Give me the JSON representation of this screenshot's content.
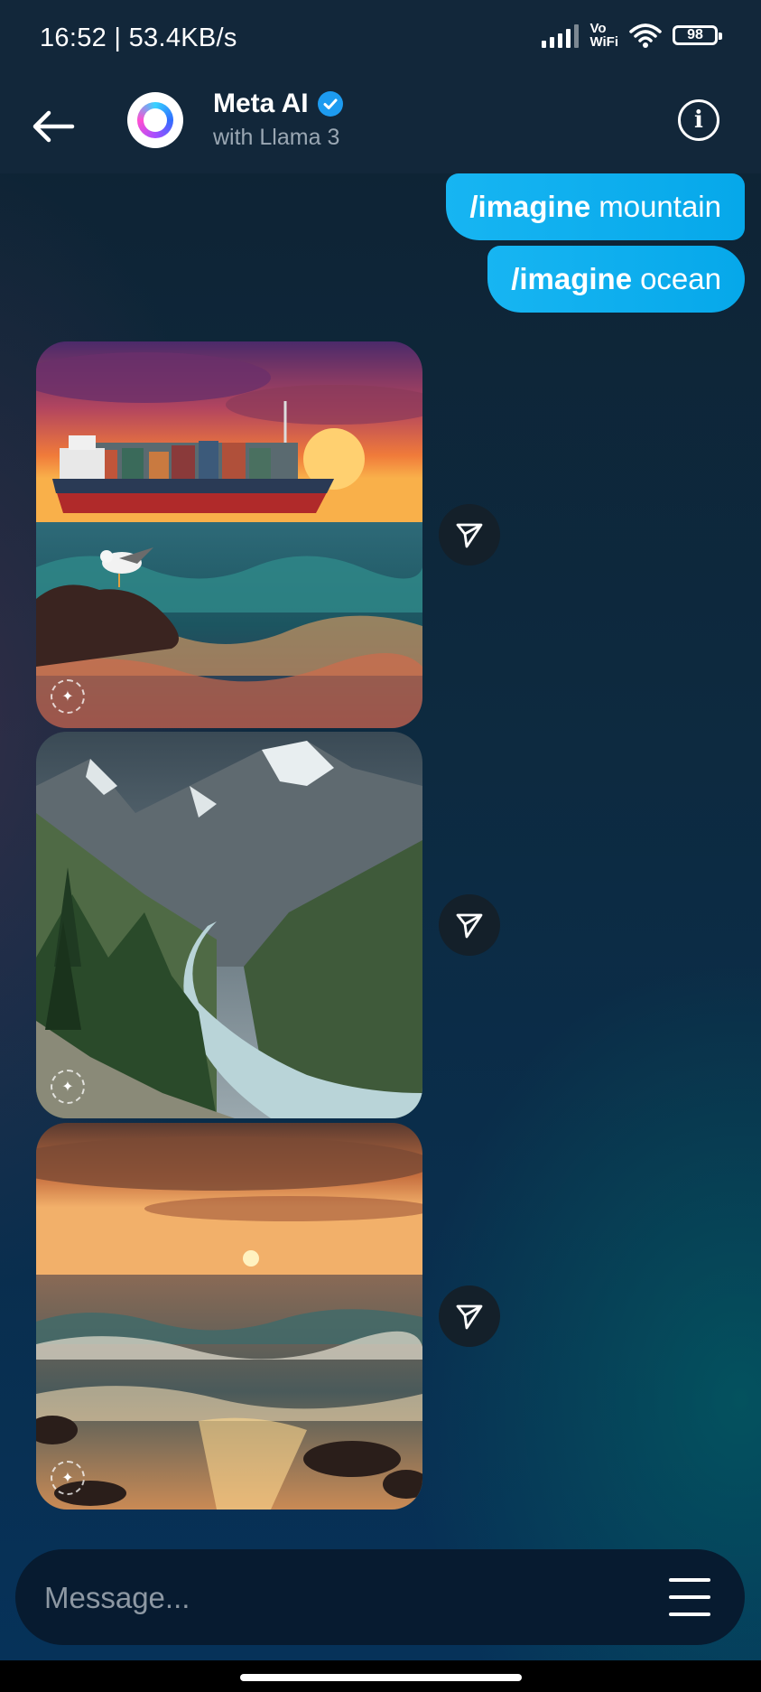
{
  "status_bar": {
    "time_speed": "16:52 | 53.4KB/s",
    "vowifi_top": "Vo",
    "vowifi_bottom": "WiFi",
    "battery": "98"
  },
  "header": {
    "contact_name": "Meta AI",
    "contact_subtitle": "with Llama 3",
    "verified": true
  },
  "messages": [
    {
      "command": "/imagine",
      "text": "mountain"
    },
    {
      "command": "/imagine",
      "text": "ocean"
    }
  ],
  "images": [
    {
      "subject": "cargo ship at sunset with seagull on rocks"
    },
    {
      "subject": "mountain valley with river"
    },
    {
      "subject": "ocean sunset with waves"
    }
  ],
  "composer": {
    "placeholder": "Message..."
  },
  "colors": {
    "bubble": "#0aaeea",
    "accent_verified": "#1d9bf0",
    "header_bg": "#12273a"
  },
  "icons": [
    "back-arrow-icon",
    "info-icon",
    "share-icon",
    "menu-icon",
    "verified-icon",
    "signal-icon",
    "wifi-icon",
    "battery-icon"
  ]
}
